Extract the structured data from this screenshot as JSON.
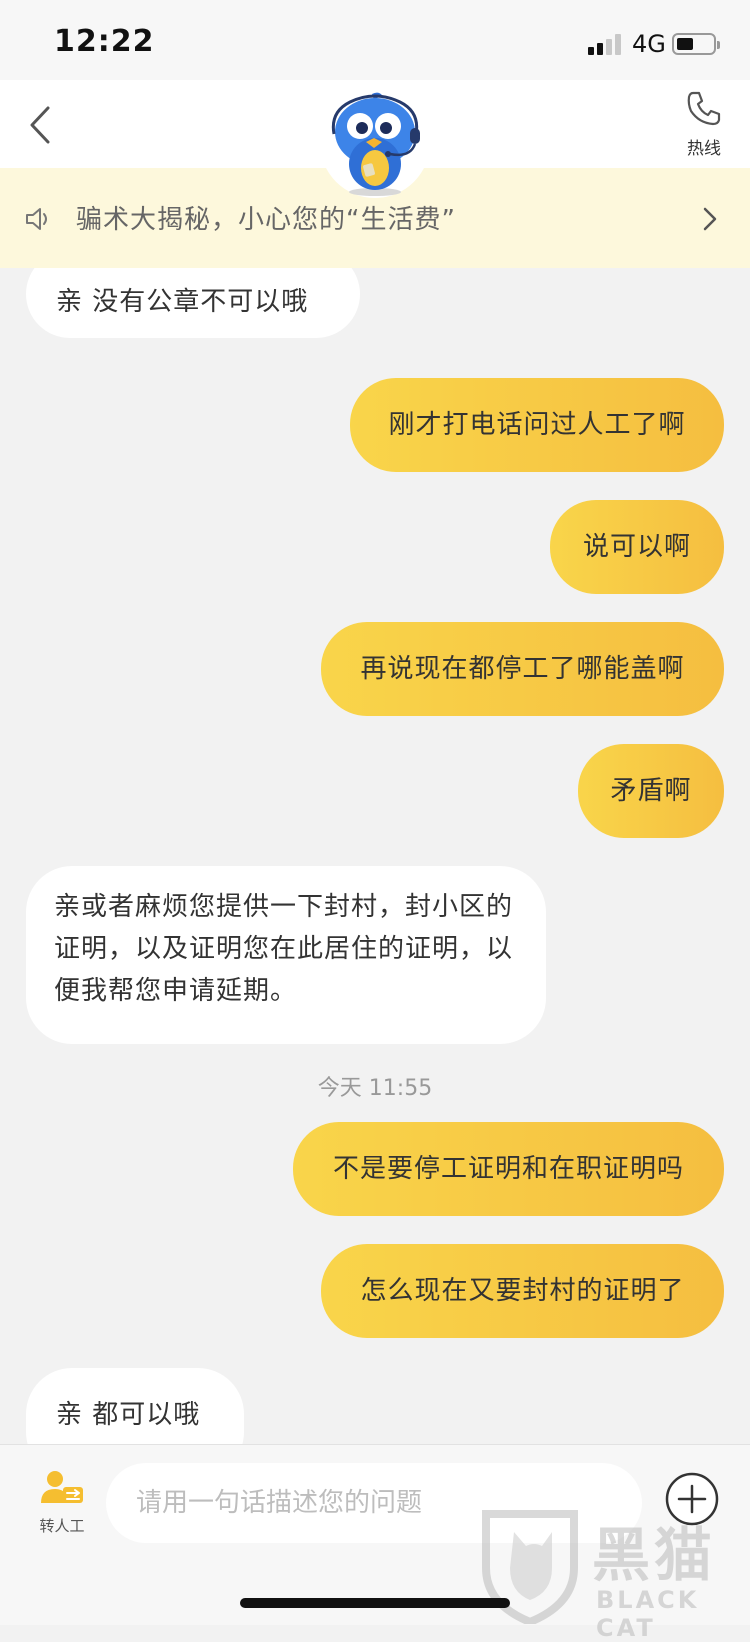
{
  "status_bar": {
    "time": "12:22",
    "network": "4G",
    "icons": [
      "signal-icon",
      "battery-icon"
    ]
  },
  "nav": {
    "hotline_label": "热线",
    "icons": [
      "back-icon",
      "mascot-icon",
      "phone-icon"
    ]
  },
  "notice": {
    "text": "骗术大揭秘，小心您的“生活费”",
    "icons": [
      "speaker-icon",
      "chevron-right-icon"
    ]
  },
  "messages": [
    {
      "side": "left",
      "text": "亲  没有公章不可以哦"
    },
    {
      "side": "right",
      "text": "刚才打电话问过人工了啊"
    },
    {
      "side": "right",
      "text": "说可以啊"
    },
    {
      "side": "right",
      "text": "再说现在都停工了哪能盖啊"
    },
    {
      "side": "right",
      "text": "矛盾啊"
    },
    {
      "side": "left",
      "text": "亲或者麻烦您提供一下封村，封小区的证明，以及证明您在此居住的证明，以便我帮您申请延期。"
    },
    {
      "side": "right",
      "text": "不是要停工证明和在职证明吗"
    },
    {
      "side": "right",
      "text": "怎么现在又要封村的证明了"
    },
    {
      "side": "left",
      "text": "亲  都可以哦"
    }
  ],
  "timestamp": "今天 11:55",
  "input_bar": {
    "agent_label": "转人工",
    "placeholder": "请用一句话描述您的问题",
    "icons": [
      "agent-icon",
      "plus-icon"
    ]
  },
  "watermark": {
    "cn": "黑猫",
    "en": "BLACK CAT"
  },
  "colors": {
    "bubble_right": "#f7c845",
    "notice_bg": "#fdf8dc",
    "chat_bg": "#f2f2f2"
  }
}
